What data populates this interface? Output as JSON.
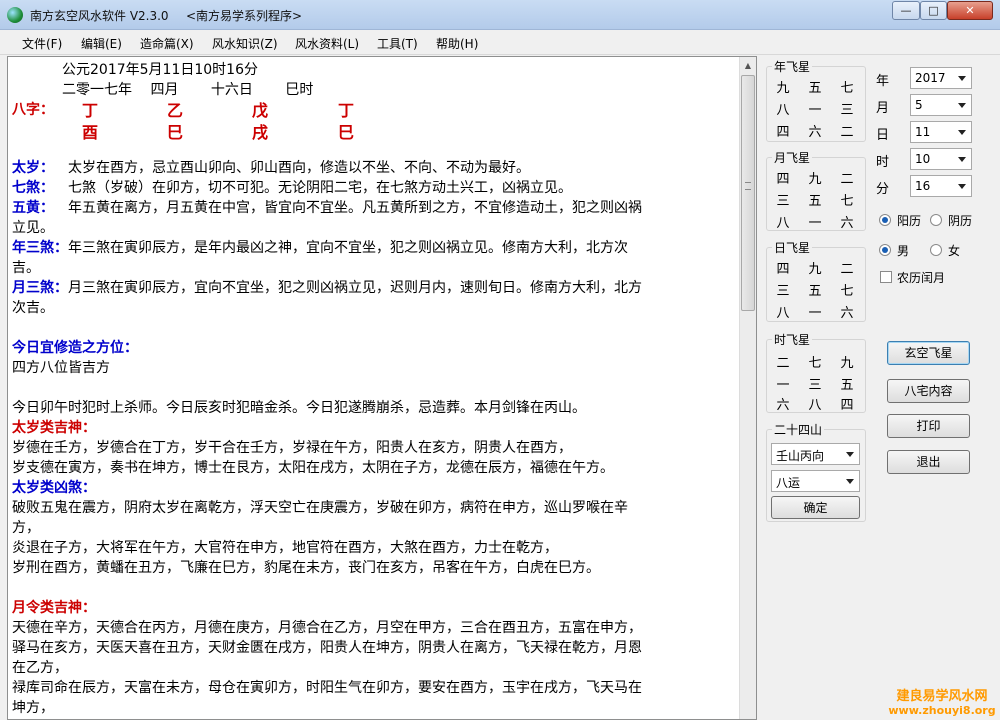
{
  "window": {
    "title": "南方玄空风水软件 V2.3.0",
    "subtitle": "<南方易学系列程序>",
    "min": "—",
    "max": "□",
    "close": "✕"
  },
  "menu": [
    "文件(F)",
    "编辑(E)",
    "造命篇(X)",
    "风水知识(Z)",
    "风水资料(L)",
    "工具(T)",
    "帮助(H)"
  ],
  "text": {
    "date_line1": "公元2017年5月11日10时16分",
    "date_line2": "二零一七年　 四月　　 十六日　　 巳时",
    "bazi_label": "八字：",
    "bazi_top": [
      "丁",
      "乙",
      "戊",
      "丁"
    ],
    "bazi_bottom": [
      "酉",
      "巳",
      "戌",
      "巳"
    ],
    "taisui_label": "太岁：",
    "taisui": "太岁在酉方，忌立酉山卯向、卯山酉向，修造以不坐、不向、不动为最好。",
    "qisha_label": "七煞：",
    "qisha": "七煞（岁破）在卯方，切不可犯。无论阴阳二宅，在七煞方动土兴工，凶祸立见。",
    "wuhuang_label": "五黄：",
    "wuhuang_1": "年五黄在离方，月五黄在中宫，皆宜向不宜坐。凡五黄所到之方，不宜修造动土，犯之则凶祸",
    "wuhuang_2": "立见。",
    "nsan_label": "年三煞：",
    "nsan_1": "年三煞在寅卯辰方，是年内最凶之神，宜向不宜坐，犯之则凶祸立见。修南方大利，北方次",
    "nsan_2": "吉。",
    "ysan_label": "月三煞：",
    "ysan_1": "月三煞在寅卯辰方，宜向不宜坐，犯之则凶祸立见，迟则月内，速则旬日。修南方大利，北方",
    "ysan_2": "次吉。",
    "today_label": "今日宜修造之方位：",
    "today": "四方八位皆吉方",
    "today_fan": "今日卯午时犯时上杀师。今日辰亥时犯暗金杀。今日犯遂腾崩杀，忌造葬。本月剑锋在丙山。",
    "taisui_ji_label": "太岁类吉神：",
    "taisui_ji_1": "岁德在壬方，岁德合在丁方，岁干合在壬方，岁禄在午方，阳贵人在亥方，阴贵人在酉方，",
    "taisui_ji_2": "岁支德在寅方，奏书在坤方，博士在艮方，太阳在戌方，太阴在子方，龙德在辰方，福德在午方。",
    "taisui_xiong_label": "太岁类凶煞：",
    "taisui_xiong_1": "破败五鬼在震方，阴府太岁在离乾方，浮天空亡在庚震方，岁破在卯方，病符在申方，巡山罗喉在辛",
    "taisui_xiong_2": "方，",
    "taisui_xiong_3": "炎退在子方，大将军在午方，大官符在申方，地官符在酉方，大煞在酉方，力士在乾方，",
    "taisui_xiong_4": "岁刑在酉方，黄蟠在丑方，飞廉在巳方，豹尾在未方，丧门在亥方，吊客在午方，白虎在巳方。",
    "yueling_label": "月令类吉神：",
    "yueling_1": "天德在辛方，天德合在丙方，月德在庚方，月德合在乙方，月空在甲方，三合在酉丑方，五富在申方，",
    "yueling_2": "驿马在亥方，天医天喜在丑方，天财金匮在戌方，阳贵人在坤方，阴贵人在离方，飞天禄在乾方，月恩",
    "yueling_3": "在乙方，",
    "yueling_4": "禄库司命在辰方，天富在未方，母仓在寅卯方，时阳生气在卯方，要安在酉方，玉宇在戌方，飞天马在",
    "yueling_5": "坤方，"
  },
  "stars": {
    "year_title": "年飞星",
    "year": [
      "九",
      "五",
      "七",
      "八",
      "一",
      "三",
      "四",
      "六",
      "二"
    ],
    "month_title": "月飞星",
    "month": [
      "四",
      "九",
      "二",
      "三",
      "五",
      "七",
      "八",
      "一",
      "六"
    ],
    "day_title": "日飞星",
    "day": [
      "四",
      "九",
      "二",
      "三",
      "五",
      "七",
      "八",
      "一",
      "六"
    ],
    "hour_title": "时飞星",
    "hour": [
      "二",
      "七",
      "九",
      "一",
      "三",
      "五",
      "六",
      "八",
      "四"
    ]
  },
  "date_fields": {
    "year_label": "年",
    "year": "2017",
    "month_label": "月",
    "month": "5",
    "day_label": "日",
    "day": "11",
    "hour_label": "时",
    "hour": "10",
    "minute_label": "分",
    "minute": "16"
  },
  "options": {
    "solar": "阳历",
    "lunar": "阴历",
    "male": "男",
    "female": "女",
    "leap": "农历闰月"
  },
  "mountain": {
    "title": "二十四山",
    "mountain_value": "壬山丙向",
    "yun_value": "八运",
    "confirm": "确定"
  },
  "buttons": {
    "xuankong": "玄空飞星",
    "bazhai": "八宅内容",
    "print": "打印",
    "exit": "退出"
  },
  "watermark": {
    "line1": "建良易学风水网",
    "line2": "www.zhouyi8.org"
  }
}
